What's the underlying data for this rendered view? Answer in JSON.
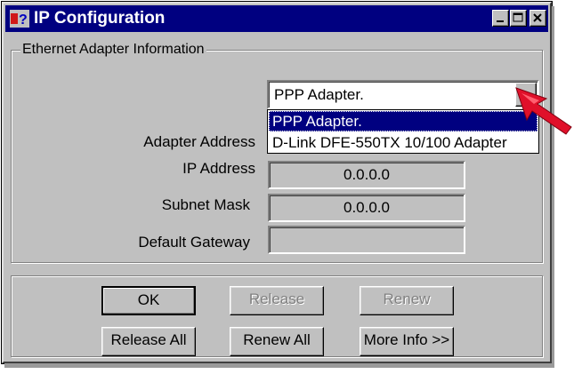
{
  "window": {
    "title": "IP Configuration",
    "icon": "help-question-icon",
    "controls": [
      "minimize-icon",
      "maximize-icon",
      "close-icon"
    ]
  },
  "adapter_group": {
    "label": "Ethernet  Adapter Information",
    "selected_adapter": "PPP Adapter.",
    "dropdown_options": [
      "PPP Adapter.",
      "D-Link DFE-550TX 10/100 Adapter"
    ],
    "fields": {
      "adapter_address": {
        "label": "Adapter Address",
        "value": ""
      },
      "ip_address": {
        "label": "IP Address",
        "value": "0.0.0.0"
      },
      "subnet_mask": {
        "label": "Subnet Mask",
        "value": "0.0.0.0"
      },
      "default_gateway": {
        "label": "Default Gateway",
        "value": ""
      }
    }
  },
  "buttons": {
    "ok": "OK",
    "release": "Release",
    "renew": "Renew",
    "release_all": "Release All",
    "renew_all": "Renew All",
    "more_info": "More Info >>"
  },
  "colors": {
    "titlebar": "#000080",
    "face": "#c0c0c0",
    "selection": "#000080",
    "pointer": "#e0102a"
  }
}
